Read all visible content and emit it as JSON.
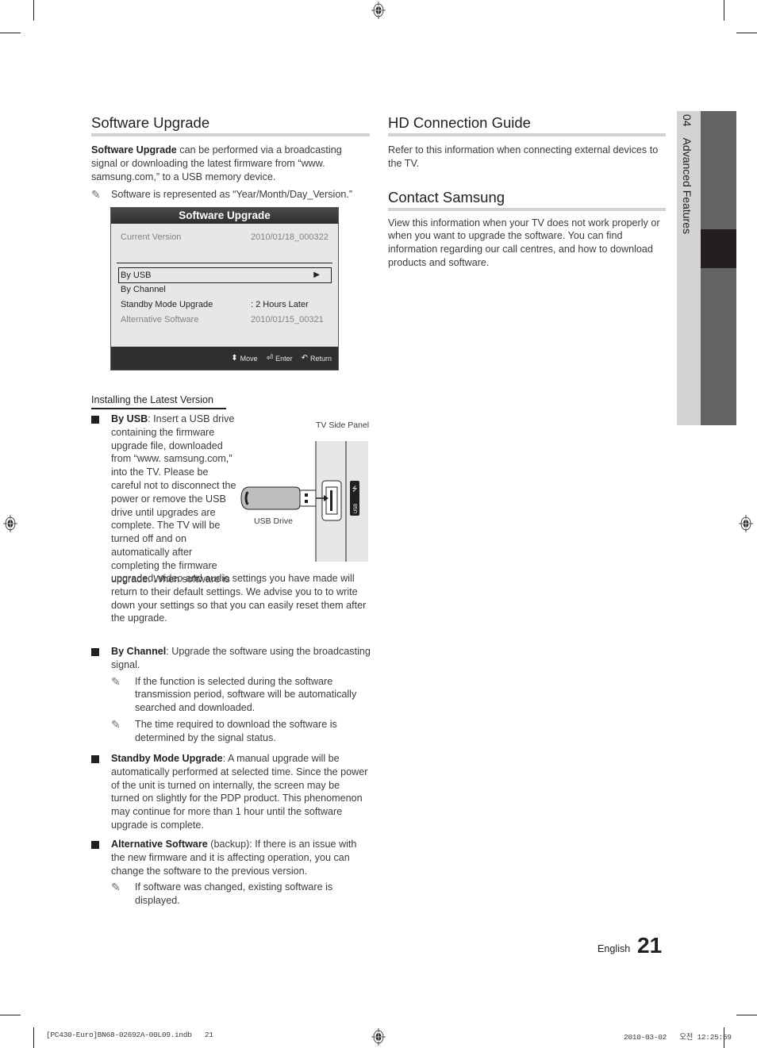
{
  "software_upgrade": {
    "heading": "Software Upgrade",
    "intro_bold": "Software Upgrade",
    "intro_rest": " can be performed via a broadcasting signal or downloading the latest firmware from “www. samsung.com,” to a USB memory device.",
    "note": "Software is represented as “Year/Month/Day_Version.”"
  },
  "osd": {
    "title": "Software Upgrade",
    "current_version_label": "Current Version",
    "current_version_value": "2010/01/18_000322",
    "menu": [
      {
        "label": "By USB",
        "value": "▶",
        "selected": true
      },
      {
        "label": "By Channel",
        "value": ""
      },
      {
        "label": "Standby Mode Upgrade",
        "value": ": 2 Hours Later"
      },
      {
        "label": "Alternative Software",
        "value": "2010/01/15_00321",
        "disabled": true
      }
    ],
    "footer": [
      {
        "icon": "up-down-icon",
        "glyph": "⬍",
        "label": "Move"
      },
      {
        "icon": "enter-icon",
        "glyph": "↵",
        "label": "Enter"
      },
      {
        "icon": "return-icon",
        "glyph": "↶",
        "label": "Return"
      }
    ]
  },
  "installing": {
    "title": "Installing the Latest Version",
    "figure": {
      "tv_side_panel_label": "TV Side Panel",
      "usb_drive_label": "USB Drive",
      "port_label": "USB"
    },
    "by_usb": {
      "bold": "By USB",
      "text_wrapped": ": Insert a USB drive containing the firmware upgrade file, downloaded from “www. samsung.com,” into the TV. Please be careful not to disconnect the power or remove the USB drive until upgrades are complete. The TV will be turned off and on automatically after completing the firmware upgrade. When software is",
      "text_continued": "upgraded, video and audio settings you have made will return to their default settings. We advise you to to write down your settings so that you can easily reset them after the upgrade."
    },
    "by_channel": {
      "bold": "By Channel",
      "text": ": Upgrade the software using the broadcasting signal.",
      "notes": [
        "If the function is selected during the software transmission period, software will be automatically searched and downloaded.",
        "The time required to download the software is determined by the signal status."
      ]
    },
    "standby": {
      "bold": "Standby Mode Upgrade",
      "text": ": A manual upgrade will be automatically performed at selected time. Since the power of the unit is turned on internally, the screen may be turned on slightly for the PDP product. This phenomenon may continue for more than 1 hour until the software upgrade is complete."
    },
    "alternative": {
      "bold": "Alternative Software",
      "text": " (backup): If there is an issue with the new firmware and it is affecting operation, you can change the software to the previous version.",
      "notes": [
        "If software was changed, existing software is displayed."
      ]
    }
  },
  "hd_connection": {
    "heading": "HD Connection Guide",
    "text": "Refer to this information when connecting external devices to the TV."
  },
  "contact": {
    "heading": "Contact Samsung",
    "text": "View this information when your TV does not work properly or when you want to upgrade the software. You can find information regarding our call centres, and how to download products and software."
  },
  "side_tab": {
    "chapter": "04",
    "title": "Advanced Features"
  },
  "footer": {
    "language": "English",
    "page_number": "21",
    "slug_left": "[PC430-Euro]BN68-02692A-00L09.indb   21",
    "slug_right": "2010-03-02   오전 12:25:59"
  },
  "colors": {
    "text": "#231f20",
    "rule": "#d1d2d4",
    "tab_light": "#d1d3d4",
    "tab_dark": "#656263",
    "tab_active": "#231f20"
  }
}
